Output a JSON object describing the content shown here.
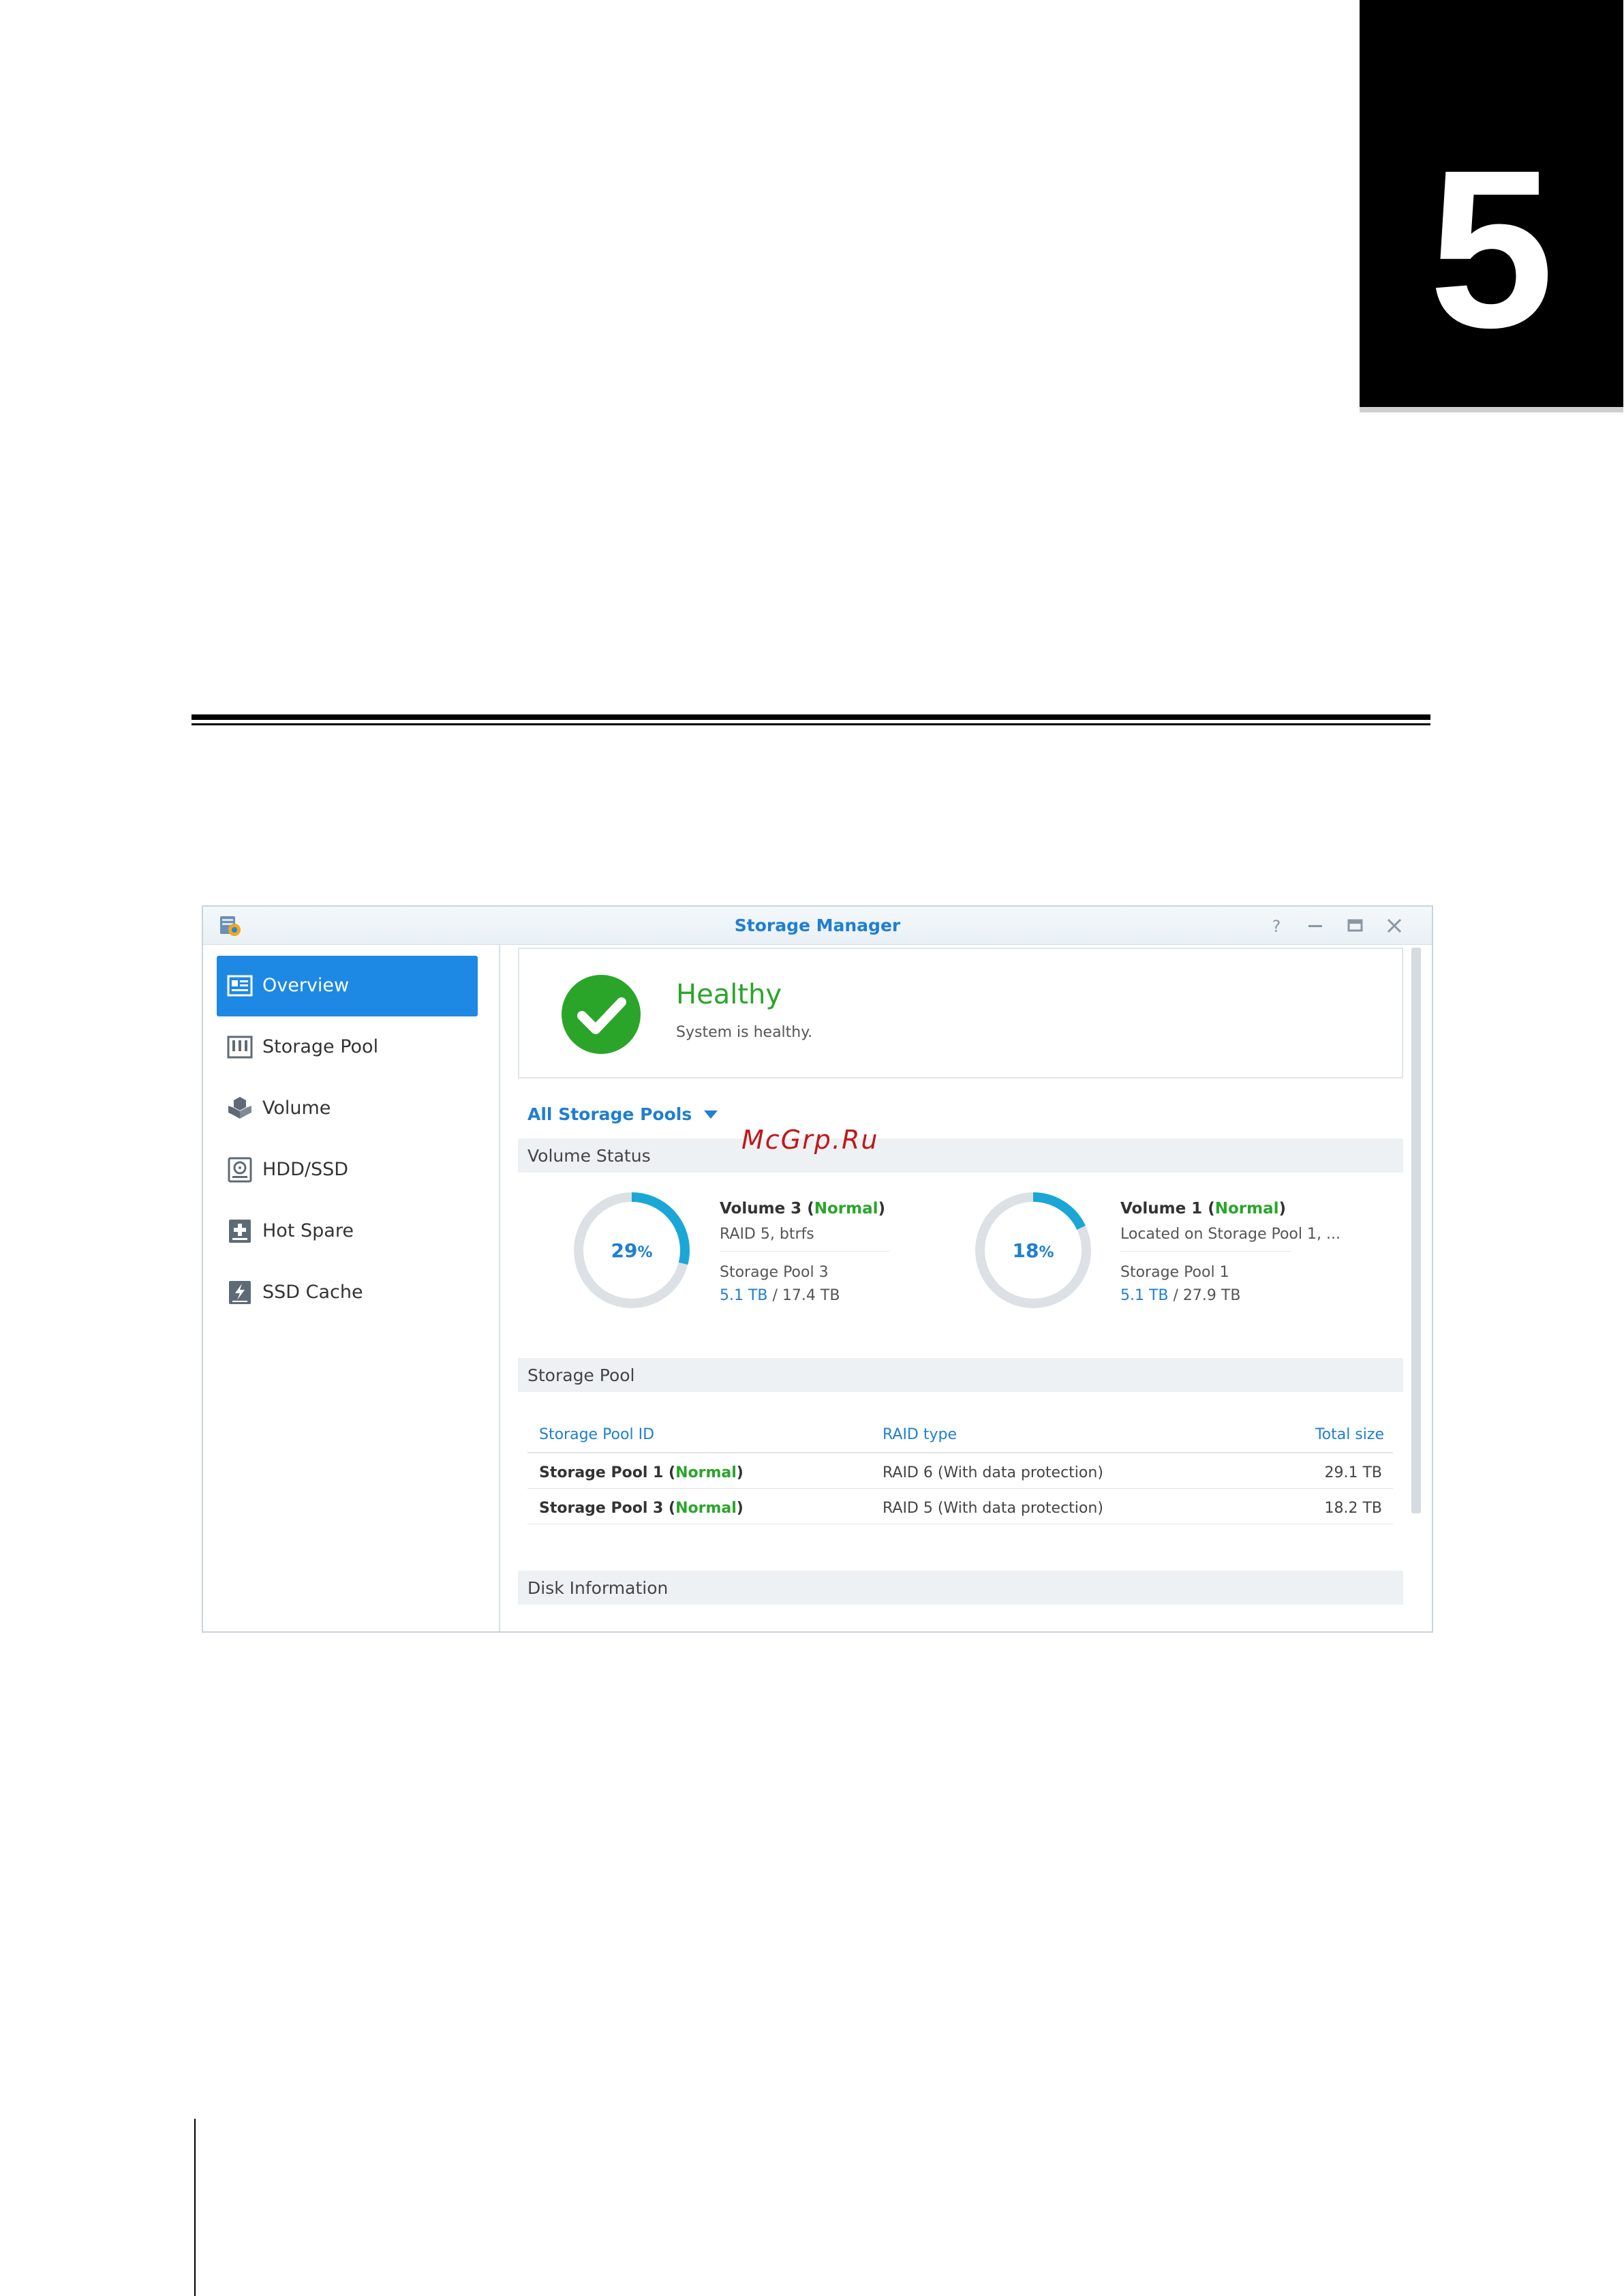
{
  "chapter": {
    "number": "5"
  },
  "window": {
    "title": "Storage Manager",
    "icons": {
      "app": "storage-manager-icon",
      "help": "help-icon",
      "minimize": "minimize-icon",
      "maximize": "maximize-icon",
      "close": "close-icon"
    }
  },
  "sidebar": {
    "items": [
      {
        "label": "Overview",
        "icon": "overview-icon",
        "active": true
      },
      {
        "label": "Storage Pool",
        "icon": "storage-pool-icon"
      },
      {
        "label": "Volume",
        "icon": "volume-icon"
      },
      {
        "label": "HDD/SSD",
        "icon": "hdd-icon"
      },
      {
        "label": "Hot Spare",
        "icon": "hot-spare-icon"
      },
      {
        "label": "SSD Cache",
        "icon": "ssd-cache-icon"
      }
    ]
  },
  "status": {
    "title": "Healthy",
    "subtitle": "System is healthy."
  },
  "filter": {
    "label": "All Storage Pools"
  },
  "watermark": "McGrp.Ru",
  "sections": {
    "volume_status": "Volume Status",
    "storage_pool": "Storage Pool",
    "disk_info": "Disk Information"
  },
  "volumes": [
    {
      "name": "Volume 3",
      "state": "Normal",
      "detail": "RAID 5, btrfs",
      "pool": "Storage Pool 3",
      "used": "5.1 TB",
      "total": " / 17.4 TB",
      "percent": 29,
      "percent_num": "29",
      "percent_sign": "%"
    },
    {
      "name": "Volume 1",
      "state": "Normal",
      "detail": "Located on Storage Pool 1, ...",
      "pool": "Storage Pool 1",
      "used": "5.1 TB",
      "total": " / 27.9 TB",
      "percent": 18,
      "percent_num": "18",
      "percent_sign": "%"
    }
  ],
  "pool_table": {
    "headers": {
      "id": "Storage Pool ID",
      "raid": "RAID type",
      "size": "Total size"
    },
    "rows": [
      {
        "name": "Storage Pool 1",
        "state": "Normal",
        "raid": "RAID 6 (With data protection)",
        "size": "29.1 TB"
      },
      {
        "name": "Storage Pool 3",
        "state": "Normal",
        "raid": "RAID 5 (With data protection)",
        "size": "18.2 TB"
      }
    ]
  },
  "colors": {
    "accent": "#1e88e5",
    "ok": "#2aa52a",
    "donut_track": "#dde1e5",
    "donut_fill": "#1aa7d6"
  }
}
